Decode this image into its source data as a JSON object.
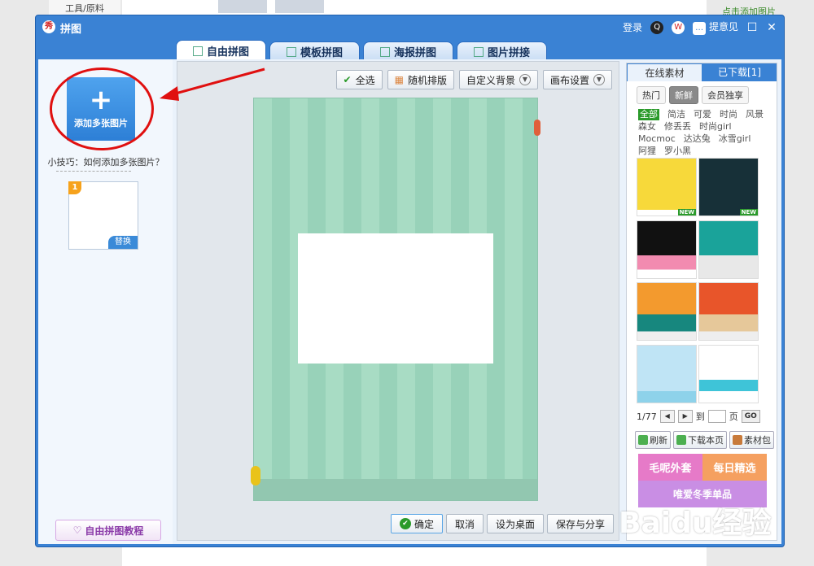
{
  "background": {
    "left_text": "工具/原料",
    "right_text": "点击添加图片"
  },
  "window": {
    "title": "拼图",
    "login": "登录",
    "feedback": "提意见",
    "tabs": [
      {
        "label": "自由拼图",
        "active": true
      },
      {
        "label": "模板拼图",
        "active": false
      },
      {
        "label": "海报拼图",
        "active": false
      },
      {
        "label": "图片拼接",
        "active": false
      }
    ]
  },
  "left": {
    "add_label": "添加多张图片",
    "tip": "小技巧：如何添加多张图片？",
    "slot_number": "1",
    "slot_replace": "替换",
    "tutorial": "自由拼图教程"
  },
  "toolbar": {
    "select_all": "全选",
    "random_layout": "随机排版",
    "custom_bg": "自定义背景",
    "canvas_settings": "画布设置"
  },
  "bottom": {
    "confirm": "确定",
    "cancel": "取消",
    "set_desktop": "设为桌面",
    "save_share": "保存与分享"
  },
  "right": {
    "tabs": [
      {
        "label": "在线素材",
        "active": true
      },
      {
        "label": "已下载[1]",
        "active": false
      }
    ],
    "subtabs": [
      {
        "label": "热门",
        "active": false
      },
      {
        "label": "新鲜",
        "active": true
      },
      {
        "label": "会员独享",
        "active": false
      }
    ],
    "categories": [
      {
        "label": "全部",
        "active": true
      },
      {
        "label": "简洁",
        "active": false
      },
      {
        "label": "可爱",
        "active": false
      },
      {
        "label": "时尚",
        "active": false
      },
      {
        "label": "风景",
        "active": false
      },
      {
        "label": "森女",
        "active": false
      },
      {
        "label": "修丢丢",
        "active": false
      },
      {
        "label": "时尚girl",
        "active": false
      },
      {
        "label": "Mocmoc",
        "active": false
      },
      {
        "label": "达达兔",
        "active": false
      },
      {
        "label": "冰雪girl",
        "active": false
      },
      {
        "label": "阿狸",
        "active": false
      },
      {
        "label": "罗小黑",
        "active": false
      }
    ],
    "thumb_new_label": "NEW",
    "pager": {
      "page": "1/77",
      "to": "到",
      "unit": "页",
      "go": "GO"
    },
    "actions": {
      "refresh": "刷新",
      "download_page": "下载本页",
      "material_pack": "素材包"
    },
    "banner": {
      "left": "毛呢外套",
      "right": "每日精选",
      "bottom": "唯爱冬季单品"
    }
  },
  "watermark": "Baidu经验",
  "colors": {
    "accent": "#3a82d4",
    "annotation": "#e01010",
    "canvas": "#a8dcc4"
  }
}
